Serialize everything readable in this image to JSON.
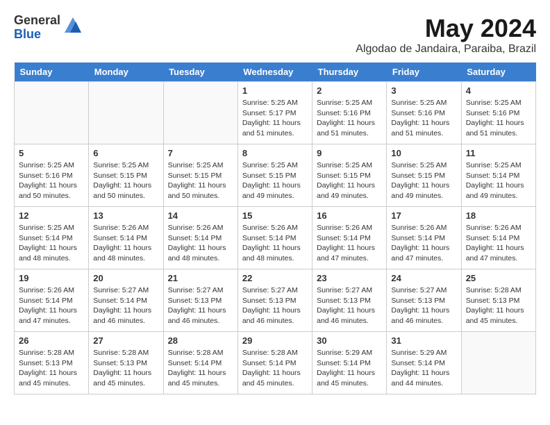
{
  "logo": {
    "general": "General",
    "blue": "Blue"
  },
  "title": "May 2024",
  "location": "Algodao de Jandaira, Paraiba, Brazil",
  "weekdays": [
    "Sunday",
    "Monday",
    "Tuesday",
    "Wednesday",
    "Thursday",
    "Friday",
    "Saturday"
  ],
  "weeks": [
    [
      {
        "day": "",
        "info": ""
      },
      {
        "day": "",
        "info": ""
      },
      {
        "day": "",
        "info": ""
      },
      {
        "day": "1",
        "info": "Sunrise: 5:25 AM\nSunset: 5:17 PM\nDaylight: 11 hours\nand 51 minutes."
      },
      {
        "day": "2",
        "info": "Sunrise: 5:25 AM\nSunset: 5:16 PM\nDaylight: 11 hours\nand 51 minutes."
      },
      {
        "day": "3",
        "info": "Sunrise: 5:25 AM\nSunset: 5:16 PM\nDaylight: 11 hours\nand 51 minutes."
      },
      {
        "day": "4",
        "info": "Sunrise: 5:25 AM\nSunset: 5:16 PM\nDaylight: 11 hours\nand 51 minutes."
      }
    ],
    [
      {
        "day": "5",
        "info": "Sunrise: 5:25 AM\nSunset: 5:16 PM\nDaylight: 11 hours\nand 50 minutes."
      },
      {
        "day": "6",
        "info": "Sunrise: 5:25 AM\nSunset: 5:15 PM\nDaylight: 11 hours\nand 50 minutes."
      },
      {
        "day": "7",
        "info": "Sunrise: 5:25 AM\nSunset: 5:15 PM\nDaylight: 11 hours\nand 50 minutes."
      },
      {
        "day": "8",
        "info": "Sunrise: 5:25 AM\nSunset: 5:15 PM\nDaylight: 11 hours\nand 49 minutes."
      },
      {
        "day": "9",
        "info": "Sunrise: 5:25 AM\nSunset: 5:15 PM\nDaylight: 11 hours\nand 49 minutes."
      },
      {
        "day": "10",
        "info": "Sunrise: 5:25 AM\nSunset: 5:15 PM\nDaylight: 11 hours\nand 49 minutes."
      },
      {
        "day": "11",
        "info": "Sunrise: 5:25 AM\nSunset: 5:14 PM\nDaylight: 11 hours\nand 49 minutes."
      }
    ],
    [
      {
        "day": "12",
        "info": "Sunrise: 5:25 AM\nSunset: 5:14 PM\nDaylight: 11 hours\nand 48 minutes."
      },
      {
        "day": "13",
        "info": "Sunrise: 5:26 AM\nSunset: 5:14 PM\nDaylight: 11 hours\nand 48 minutes."
      },
      {
        "day": "14",
        "info": "Sunrise: 5:26 AM\nSunset: 5:14 PM\nDaylight: 11 hours\nand 48 minutes."
      },
      {
        "day": "15",
        "info": "Sunrise: 5:26 AM\nSunset: 5:14 PM\nDaylight: 11 hours\nand 48 minutes."
      },
      {
        "day": "16",
        "info": "Sunrise: 5:26 AM\nSunset: 5:14 PM\nDaylight: 11 hours\nand 47 minutes."
      },
      {
        "day": "17",
        "info": "Sunrise: 5:26 AM\nSunset: 5:14 PM\nDaylight: 11 hours\nand 47 minutes."
      },
      {
        "day": "18",
        "info": "Sunrise: 5:26 AM\nSunset: 5:14 PM\nDaylight: 11 hours\nand 47 minutes."
      }
    ],
    [
      {
        "day": "19",
        "info": "Sunrise: 5:26 AM\nSunset: 5:14 PM\nDaylight: 11 hours\nand 47 minutes."
      },
      {
        "day": "20",
        "info": "Sunrise: 5:27 AM\nSunset: 5:14 PM\nDaylight: 11 hours\nand 46 minutes."
      },
      {
        "day": "21",
        "info": "Sunrise: 5:27 AM\nSunset: 5:13 PM\nDaylight: 11 hours\nand 46 minutes."
      },
      {
        "day": "22",
        "info": "Sunrise: 5:27 AM\nSunset: 5:13 PM\nDaylight: 11 hours\nand 46 minutes."
      },
      {
        "day": "23",
        "info": "Sunrise: 5:27 AM\nSunset: 5:13 PM\nDaylight: 11 hours\nand 46 minutes."
      },
      {
        "day": "24",
        "info": "Sunrise: 5:27 AM\nSunset: 5:13 PM\nDaylight: 11 hours\nand 46 minutes."
      },
      {
        "day": "25",
        "info": "Sunrise: 5:28 AM\nSunset: 5:13 PM\nDaylight: 11 hours\nand 45 minutes."
      }
    ],
    [
      {
        "day": "26",
        "info": "Sunrise: 5:28 AM\nSunset: 5:13 PM\nDaylight: 11 hours\nand 45 minutes."
      },
      {
        "day": "27",
        "info": "Sunrise: 5:28 AM\nSunset: 5:13 PM\nDaylight: 11 hours\nand 45 minutes."
      },
      {
        "day": "28",
        "info": "Sunrise: 5:28 AM\nSunset: 5:14 PM\nDaylight: 11 hours\nand 45 minutes."
      },
      {
        "day": "29",
        "info": "Sunrise: 5:28 AM\nSunset: 5:14 PM\nDaylight: 11 hours\nand 45 minutes."
      },
      {
        "day": "30",
        "info": "Sunrise: 5:29 AM\nSunset: 5:14 PM\nDaylight: 11 hours\nand 45 minutes."
      },
      {
        "day": "31",
        "info": "Sunrise: 5:29 AM\nSunset: 5:14 PM\nDaylight: 11 hours\nand 44 minutes."
      },
      {
        "day": "",
        "info": ""
      }
    ]
  ]
}
